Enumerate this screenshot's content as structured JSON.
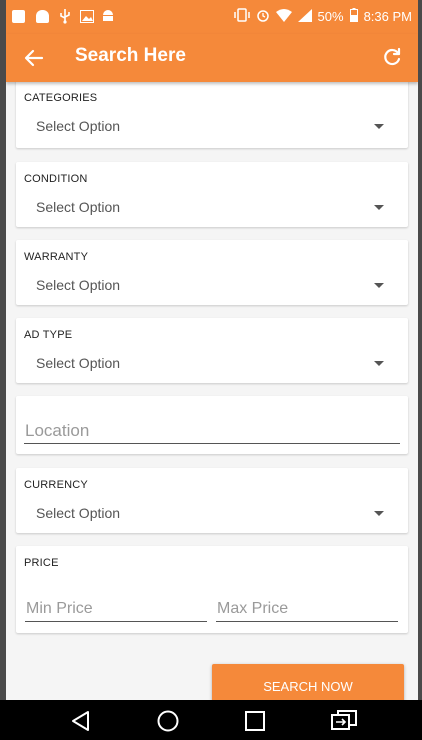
{
  "status_bar": {
    "battery": "50%",
    "time": "8:36 PM"
  },
  "app_bar": {
    "title": "Search Here",
    "back_icon": "arrow-left-icon",
    "refresh_icon": "refresh-icon"
  },
  "form": {
    "categories": {
      "label": "CATEGORIES",
      "value": "Select Option"
    },
    "condition": {
      "label": "CONDITION",
      "value": "Select Option"
    },
    "warranty": {
      "label": "WARRANTY",
      "value": "Select Option"
    },
    "ad_type": {
      "label": "AD TYPE",
      "value": "Select Option"
    },
    "location": {
      "placeholder": "Location",
      "value": ""
    },
    "currency": {
      "label": "CURRENCY",
      "value": "Select Option"
    },
    "price": {
      "label": "PRICE",
      "min_placeholder": "Min Price",
      "max_placeholder": "Max Price"
    }
  },
  "search_button": {
    "label": "SEARCH NOW"
  },
  "colors": {
    "accent": "#f5893a",
    "background": "#f5f5f5",
    "card": "#ffffff"
  }
}
